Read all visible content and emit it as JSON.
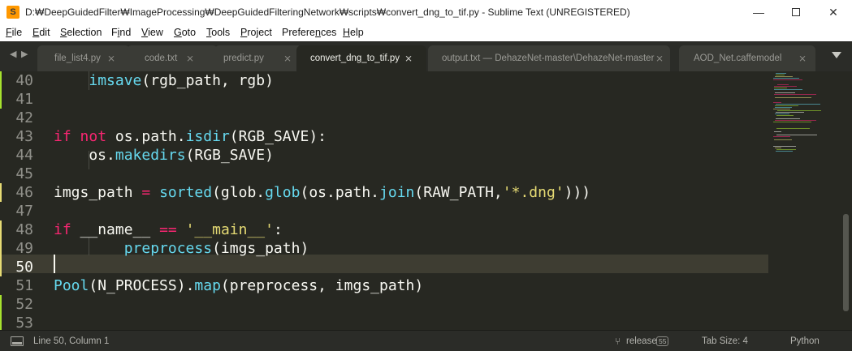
{
  "window": {
    "title": "D:₩DeepGuidedFilter₩ImageProcessing₩DeepGuidedFilteringNetwork₩scripts₩convert_dng_to_tif.py - Sublime Text (UNREGISTERED)",
    "minimize": "—",
    "close": "✕"
  },
  "menu": [
    {
      "pre": "",
      "ul": "F",
      "post": "ile"
    },
    {
      "pre": "",
      "ul": "E",
      "post": "dit"
    },
    {
      "pre": "",
      "ul": "S",
      "post": "election"
    },
    {
      "pre": "F",
      "ul": "i",
      "post": "nd"
    },
    {
      "pre": "",
      "ul": "V",
      "post": "iew"
    },
    {
      "pre": "",
      "ul": "G",
      "post": "oto"
    },
    {
      "pre": "",
      "ul": "T",
      "post": "ools"
    },
    {
      "pre": "",
      "ul": "P",
      "post": "roject"
    },
    {
      "pre": "Prefere",
      "ul": "n",
      "post": "ces"
    },
    {
      "pre": "",
      "ul": "H",
      "post": "elp"
    }
  ],
  "tabs": [
    {
      "label": "file_list4.py",
      "active": false
    },
    {
      "label": "code.txt",
      "active": false
    },
    {
      "label": "predict.py",
      "active": false
    },
    {
      "label": "convert_dng_to_tif.py",
      "active": true
    },
    {
      "label": "output.txt — DehazeNet-master\\DehazeNet-master",
      "active": false
    },
    {
      "label": "AOD_Net.caffemodel",
      "active": false
    }
  ],
  "tab_nav": {
    "left": "◀",
    "right": "▶"
  },
  "tab_close_glyph": "⨯",
  "editor": {
    "current_line": 50,
    "lines": [
      {
        "num": "40",
        "mod": "green",
        "tokens": [
          [
            "pl",
            "    "
          ],
          [
            "fn",
            "imsave"
          ],
          [
            "pl",
            "(rgb_path, rgb)"
          ]
        ]
      },
      {
        "num": "41",
        "mod": "green",
        "tokens": []
      },
      {
        "num": "42",
        "mod": "",
        "tokens": []
      },
      {
        "num": "43",
        "mod": "",
        "tokens": [
          [
            "kw",
            "if"
          ],
          [
            "pl",
            " "
          ],
          [
            "kw",
            "not"
          ],
          [
            "pl",
            " os.path."
          ],
          [
            "fn",
            "isdir"
          ],
          [
            "pl",
            "(RGB_SAVE):"
          ]
        ]
      },
      {
        "num": "44",
        "mod": "",
        "tokens": [
          [
            "pl",
            "    os."
          ],
          [
            "fn",
            "makedirs"
          ],
          [
            "pl",
            "(RGB_SAVE)"
          ]
        ]
      },
      {
        "num": "45",
        "mod": "",
        "tokens": []
      },
      {
        "num": "46",
        "mod": "yellow",
        "tokens": [
          [
            "pl",
            "imgs_path "
          ],
          [
            "op",
            "="
          ],
          [
            "pl",
            " "
          ],
          [
            "fn",
            "sorted"
          ],
          [
            "pl",
            "(glob."
          ],
          [
            "fn",
            "glob"
          ],
          [
            "pl",
            "(os.path."
          ],
          [
            "fn",
            "join"
          ],
          [
            "pl",
            "(RAW_PATH,"
          ],
          [
            "str",
            "'*.dng'"
          ],
          [
            "pl",
            ")))"
          ]
        ]
      },
      {
        "num": "47",
        "mod": "",
        "tokens": []
      },
      {
        "num": "48",
        "mod": "yellow",
        "tokens": [
          [
            "kw",
            "if"
          ],
          [
            "pl",
            " __name__ "
          ],
          [
            "op",
            "=="
          ],
          [
            "pl",
            " "
          ],
          [
            "str",
            "'__main__'"
          ],
          [
            "pl",
            ":"
          ]
        ]
      },
      {
        "num": "49",
        "mod": "yellow",
        "tokens": [
          [
            "pl",
            "        "
          ],
          [
            "fn",
            "preprocess"
          ],
          [
            "pl",
            "(imgs_path)"
          ]
        ]
      },
      {
        "num": "50",
        "mod": "yellow",
        "tokens": []
      },
      {
        "num": "51",
        "mod": "",
        "tokens": [
          [
            "fn",
            "Pool"
          ],
          [
            "pl",
            "(N_PROCESS)."
          ],
          [
            "fn",
            "map"
          ],
          [
            "pl",
            "(preprocess, imgs_path)"
          ]
        ]
      },
      {
        "num": "52",
        "mod": "green",
        "tokens": []
      },
      {
        "num": "53",
        "mod": "green",
        "tokens": []
      }
    ]
  },
  "status": {
    "position": "Line 50, Column 1",
    "branch": "release",
    "branch_badge": "55",
    "tab_size": "Tab Size: 4",
    "syntax": "Python"
  },
  "colors": {
    "editor_bg": "#272822",
    "keyword": "#f92672",
    "function": "#66d9ef",
    "string": "#e6db74",
    "plain": "#f8f8f2",
    "line_number": "#90908a",
    "modified_green": "#a6e22e",
    "modified_yellow": "#e6db74"
  }
}
